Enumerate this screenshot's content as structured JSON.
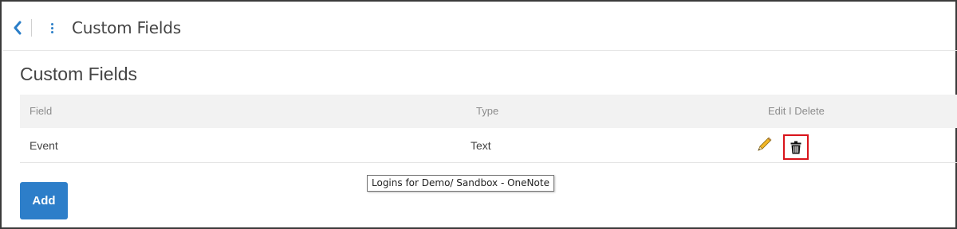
{
  "topbar": {
    "title": "Custom Fields",
    "back_icon": "chevron-left-icon",
    "menu_icon": "kebab-menu-icon"
  },
  "page": {
    "title": "Custom Fields"
  },
  "table": {
    "columns": [
      "Field",
      "Type",
      "Edit I Delete"
    ],
    "rows": [
      {
        "field": "Event",
        "type": "Text"
      }
    ]
  },
  "actions": {
    "edit_icon": "pencil-icon",
    "delete_icon": "trash-icon",
    "add_label": "Add"
  },
  "tooltip": {
    "text": "Logins for Demo/ Sandbox - OneNote"
  },
  "colors": {
    "accent": "#2d7ec9",
    "highlight_box": "#d9141b",
    "header_bg": "#f2f2f2"
  }
}
